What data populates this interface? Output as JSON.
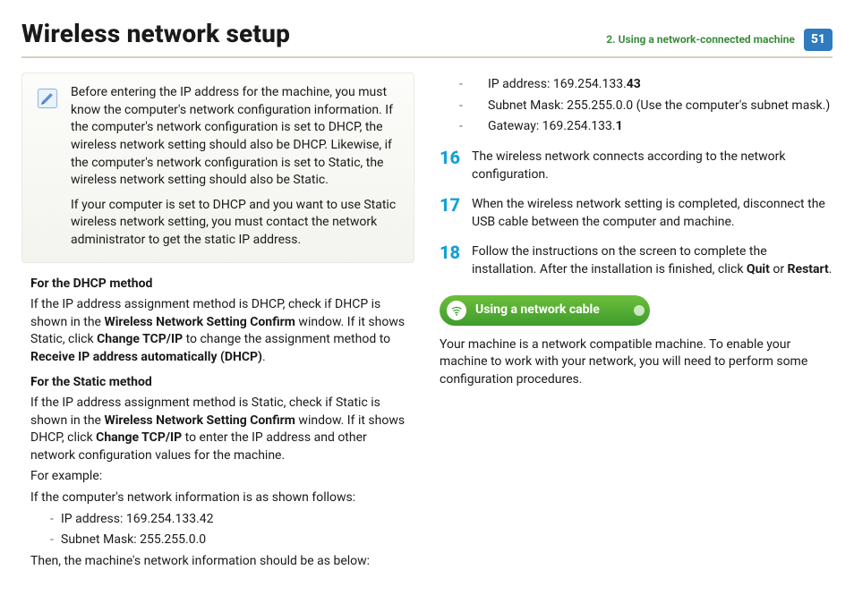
{
  "header": {
    "title": "Wireless network setup",
    "chapter_prefix": "2.  ",
    "chapter": "Using a network-connected machine",
    "page_number": "51"
  },
  "note": {
    "p1": "Before entering the IP address for the machine, you must know the computer's network configuration information. If the computer's network configuration is set to DHCP, the wireless network setting should also be DHCP. Likewise, if the computer's network configuration is set to Static, the wireless network setting should also be Static.",
    "p2": "If your computer is set to DHCP and you want to use Static wireless network setting, you must contact the network administrator to get the static IP address."
  },
  "dhcp": {
    "title": "For the DHCP method",
    "seg1": "If the IP address assignment method is DHCP, check if DHCP is shown in the ",
    "b1": "Wireless Network Setting Confirm",
    "seg2": " window. If it shows Static, click ",
    "b2": "Change TCP/IP",
    "seg3": " to change the assignment method to ",
    "b3": "Receive IP address automatically (DHCP)",
    "seg4": "."
  },
  "static": {
    "title": "For the Static method",
    "seg1": "If the IP address assignment method is Static, check if Static is shown in the ",
    "b1": "Wireless Network Setting Confirm",
    "seg2": " window. If it shows DHCP, click ",
    "b2": "Change TCP/IP",
    "seg3": " to enter the IP address and other network configuration values for the machine.",
    "for_example": "For example:",
    "comp_lead": "If the computer's network information is as shown follows:",
    "comp_ip": "IP address: 169.254.133.42",
    "comp_mask": "Subnet Mask: 255.255.0.0",
    "then_lead": "Then, the machine's network information should be as below:"
  },
  "machine": {
    "ip_pre": "IP address: 169.254.133.",
    "ip_bold": "43",
    "mask": "Subnet Mask: 255.255.0.0 (Use the computer's subnet mask.)",
    "gw_pre": "Gateway: 169.254.133.",
    "gw_bold": "1"
  },
  "steps": {
    "s16": {
      "num": "16",
      "text": "The wireless network connects according to the network configuration."
    },
    "s17": {
      "num": "17",
      "text": "When the wireless network setting is completed, disconnect the USB cable between the computer and machine."
    },
    "s18": {
      "num": "18",
      "seg1": "Follow the instructions on the screen to complete the installation. After the installation is finished, click ",
      "b1": "Quit",
      "seg2": " or ",
      "b2": "Restart",
      "seg3": "."
    }
  },
  "section": {
    "title": "Using a network cable",
    "body": "Your machine is a network compatible machine. To enable your machine to work with your network, you will need to perform some configuration procedures."
  }
}
